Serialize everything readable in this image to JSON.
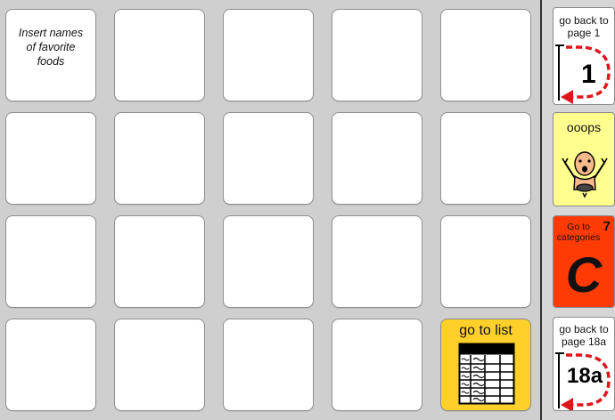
{
  "grid": {
    "first_cell_text": "Insert names\nof favorite\nfoods",
    "go_to_list_label": "go to list"
  },
  "rail": {
    "back_page1_label": "go back to\npage 1",
    "back_page1_number": "1",
    "oops_label": "ooops",
    "categories_label": "Go to\ncategories",
    "categories_number": "7",
    "categories_letter": "C",
    "back_page18a_label": "go back to\npage 18a",
    "back_page18a_number": "18a"
  },
  "colors": {
    "background": "#cfcfcf",
    "cell": "#ffffff",
    "go_to_list": "#ffd02a",
    "oops": "#ffff8f",
    "categories": "#ff3b05",
    "arrow": "#e0151b"
  },
  "icons": {
    "go_to_list": "list-table-icon",
    "back": "return-arrow-icon",
    "oops": "oops-face-icon"
  }
}
